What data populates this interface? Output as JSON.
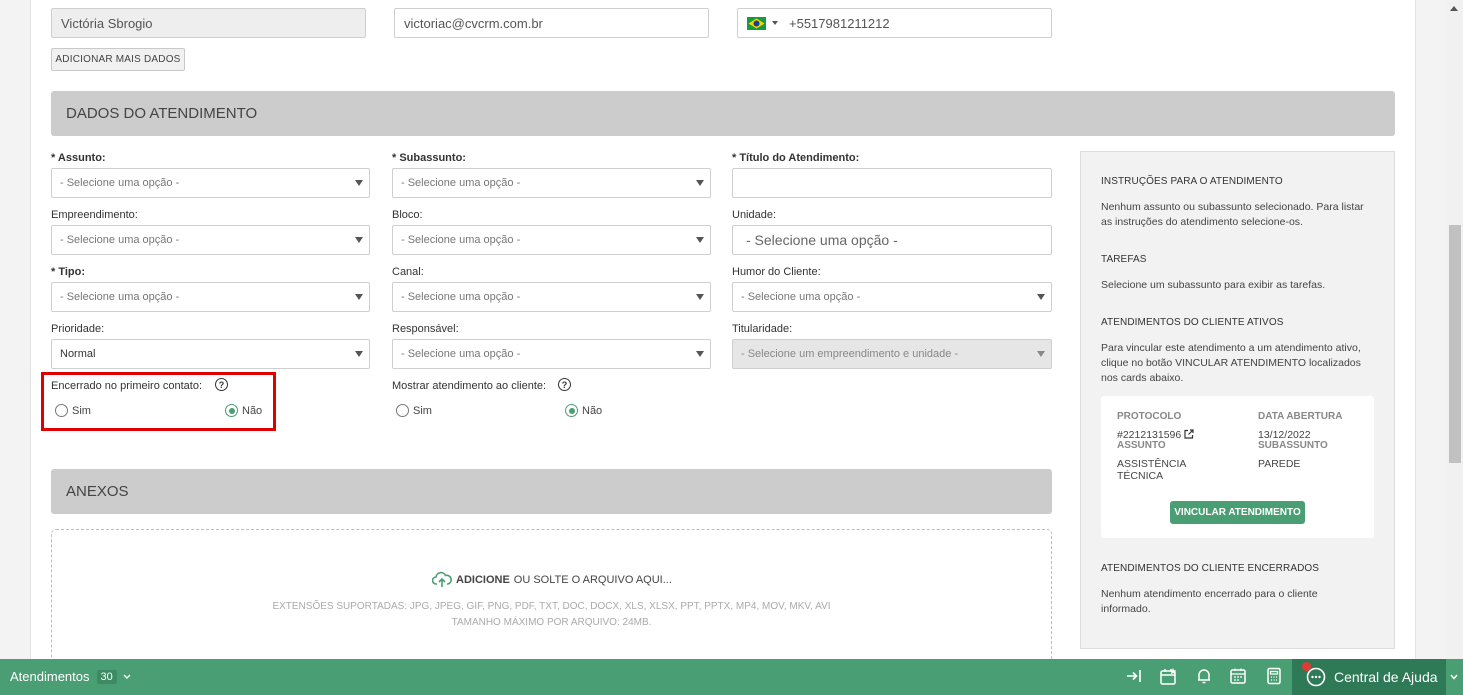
{
  "contact": {
    "name": "Victória Sbrogio",
    "email": "victoriac@cvcrm.com.br",
    "phone": "+5517981211212",
    "add_more_label": "ADICIONAR MAIS DADOS"
  },
  "sections": {
    "dados": "DADOS DO ATENDIMENTO",
    "anexos": "ANEXOS"
  },
  "form": {
    "assunto_label": "* Assunto:",
    "subassunto_label": "* Subassunto:",
    "titulo_label": "* Título do Atendimento:",
    "empreendimento_label": "Empreendimento:",
    "bloco_label": "Bloco:",
    "unidade_label": "Unidade:",
    "tipo_label": "* Tipo:",
    "canal_label": "Canal:",
    "humor_label": "Humor do Cliente:",
    "prioridade_label": "Prioridade:",
    "responsavel_label": "Responsável:",
    "titularidade_label": "Titularidade:",
    "placeholder": "- Selecione uma opção -",
    "unidade_placeholder": "- Selecione uma opção -",
    "titularidade_placeholder": "- Selecione um empreendimento e unidade -",
    "prioridade_value": "Normal",
    "titulo_value": "",
    "encerrado_label": "Encerrado no primeiro contato:",
    "mostrar_label": "Mostrar atendimento ao cliente:",
    "sim": "Sim",
    "nao": "Não",
    "encerrado_value": "Não",
    "mostrar_value": "Não"
  },
  "attachments": {
    "add": "ADICIONE",
    "rest": "OU SOLTE O ARQUIVO AQUI...",
    "extensions": "EXTENSÕES SUPORTADAS: JPG, JPEG, GIF, PNG, PDF, TXT, DOC, DOCX, XLS, XLSX, PPT, PPTX, MP4, MOV, MKV, AVI",
    "max_size": "TAMANHO MÁXIMO POR ARQUIVO: 24MB."
  },
  "sidebar": {
    "instr_title": "INSTRUÇÕES PARA O ATENDIMENTO",
    "instr_text": "Nenhum assunto ou subassunto selecionado. Para listar as instruções do atendimento selecione-os.",
    "tarefas_title": "TAREFAS",
    "tarefas_text": "Selecione um subassunto para exibir as tarefas.",
    "ativos_title": "ATENDIMENTOS DO CLIENTE ATIVOS",
    "ativos_text": "Para vincular este atendimento a um atendimento ativo, clique no botão VINCULAR ATENDIMENTO localizados nos cards abaixo.",
    "card": {
      "protocolo_h": "PROTOCOLO",
      "protocolo_v": "#2212131596",
      "data_h": "DATA ABERTURA",
      "data_v": "13/12/2022",
      "assunto_h": "ASSUNTO",
      "assunto_v": "ASSISTÊNCIA TÉCNICA",
      "subassunto_h": "SUBASSUNTO",
      "subassunto_v": "PAREDE",
      "vincular": "VINCULAR ATENDIMENTO"
    },
    "encerrados_title": "ATENDIMENTOS DO CLIENTE ENCERRADOS",
    "encerrados_text": "Nenhum atendimento encerrado para o cliente informado."
  },
  "bottom": {
    "atendimentos": "Atendimentos",
    "count": "30",
    "help": "Central de Ajuda"
  },
  "colors": {
    "accent": "#4a9e74",
    "highlight": "#e00000"
  }
}
